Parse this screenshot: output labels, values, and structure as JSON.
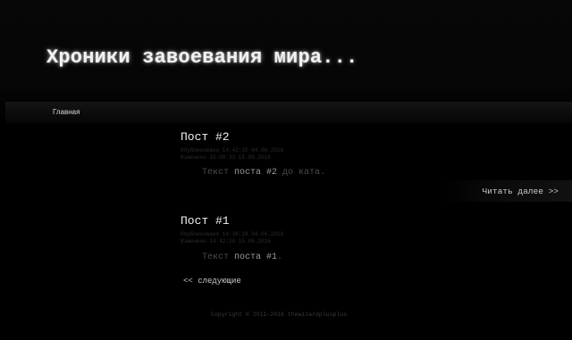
{
  "header": {
    "site_title": "Хроники завоевания мира..."
  },
  "nav": {
    "home_label": "Главная"
  },
  "posts": [
    {
      "title": "Пост #2",
      "meta_published": "Опубликовано 14:42:35 04.06.2016",
      "meta_edited": "Изменено 15:09:33 15.06.2016",
      "body_prefix": "Текст ",
      "body_middle": "поста #2",
      "body_suffix": " до ката.",
      "read_more_label": "Читать далее >>"
    },
    {
      "title": "Пост #1",
      "meta_published": "Опубликовано 14:38:28 04.06.2016",
      "meta_edited": "Изменено 14:42:20 15.06.2016",
      "body_prefix": "Текст ",
      "body_middle": "поста #1",
      "body_suffix": "."
    }
  ],
  "pager": {
    "next_label": "<< следующие"
  },
  "footer": {
    "copyright": "Copyright © 2011-2016 thewizardplusplus"
  }
}
